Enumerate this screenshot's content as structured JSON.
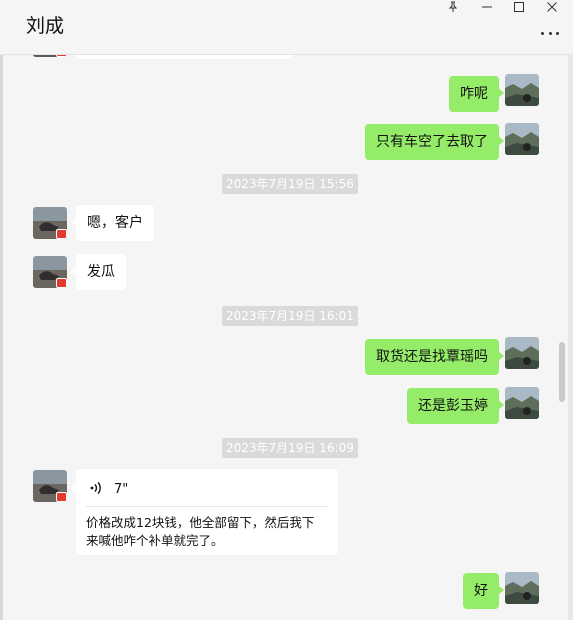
{
  "window": {
    "title": "刘成",
    "pin_icon": "pin-icon",
    "minimize_icon": "minimize-icon",
    "maximize_icon": "maximize-icon",
    "close_icon": "close-icon",
    "more_icon": "more-icon"
  },
  "colors": {
    "outgoing_bubble": "#95ec69",
    "incoming_bubble": "#ffffff",
    "timestamp_bg": "#dadada",
    "background": "#f5f5f5"
  },
  "messages": {
    "m1": "咋呢",
    "m2": "只有车空了去取了",
    "t1": "2023年7月19日 15:56",
    "m3": "嗯，客户",
    "m4": "发瓜",
    "t2": "2023年7月19日 16:01",
    "m5": "取货还是找覃瑶吗",
    "m6": "还是彭玉婷",
    "t3": "2023年7月19日 16:09",
    "voice": {
      "icon": "voice-wave-icon",
      "duration": "7\"",
      "transcript": "价格改成12块钱，他全部留下，然后我下来喊他咋个补单就完了。"
    },
    "m7": "好"
  }
}
